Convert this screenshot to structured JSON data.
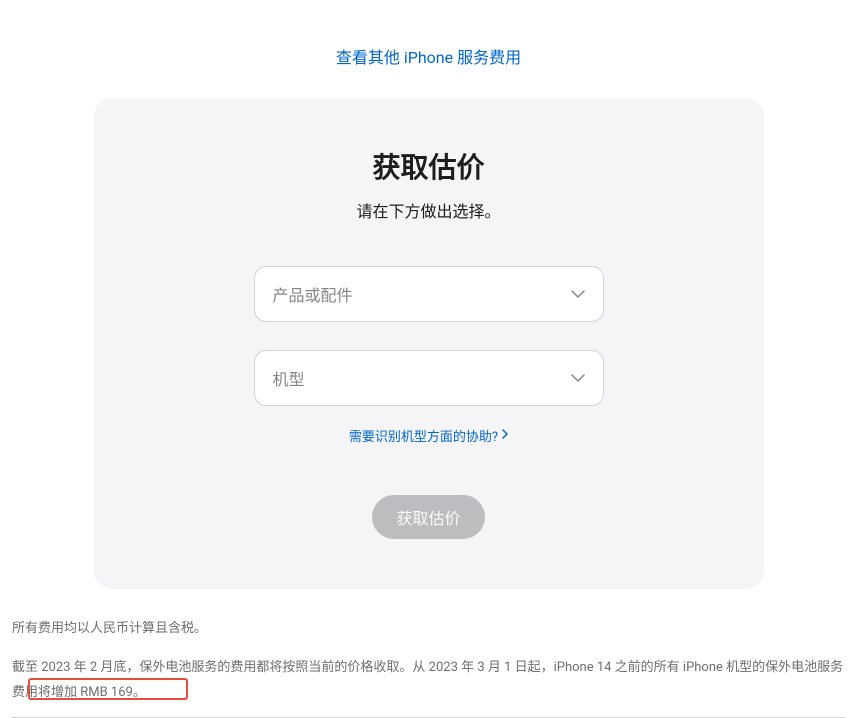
{
  "topLink": "查看其他 iPhone 服务费用",
  "card": {
    "title": "获取估价",
    "subtitle": "请在下方做出选择。",
    "select1": {
      "placeholder": "产品或配件"
    },
    "select2": {
      "placeholder": "机型"
    },
    "helpLink": "需要识别机型方面的协助?",
    "submitLabel": "获取估价"
  },
  "footer": {
    "line1": "所有费用均以人民币计算且含税。",
    "line2": "截至 2023 年 2 月底，保外电池服务的费用都将按照当前的价格收取。从 2023 年 3 月 1 日起，iPhone 14 之前的所有 iPhone 机型的保外电池服务费用将增加 RMB 169。"
  }
}
